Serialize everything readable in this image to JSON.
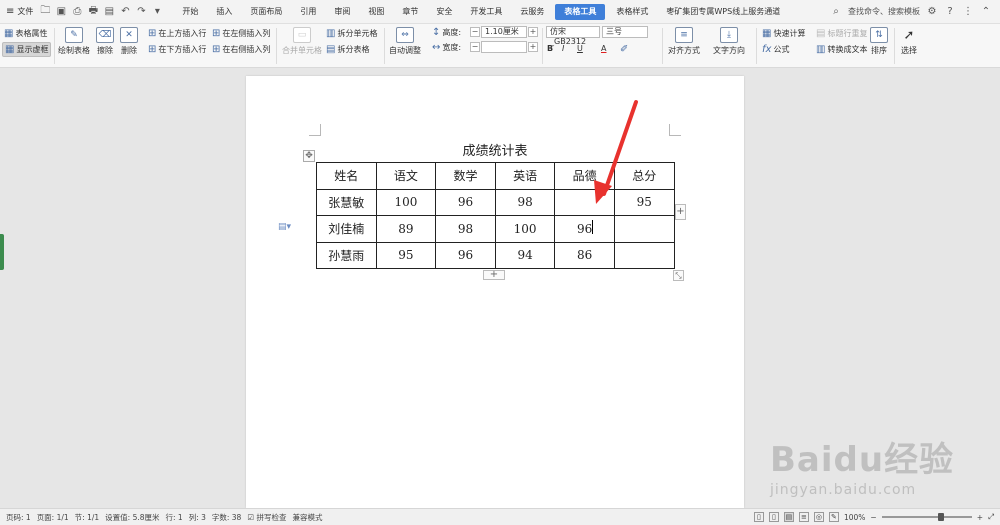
{
  "menu": {
    "file": "文件",
    "tabs": [
      "开始",
      "插入",
      "页面布局",
      "引用",
      "审阅",
      "视图",
      "章节",
      "安全",
      "开发工具",
      "云服务",
      "表格工具",
      "表格样式",
      "枣矿集团专属WPS线上服务通道"
    ],
    "active_tab": "表格工具",
    "search": "查找命令、搜索模板"
  },
  "ribbon": {
    "table_props": "表格属性",
    "show_gridlines": "显示虚框",
    "draw_table": "绘制表格",
    "erase": "擦除",
    "delete": "删除",
    "insert_above": "在上方插入行",
    "insert_below": "在下方插入行",
    "insert_left": "在左侧插入列",
    "insert_right": "在右侧插入列",
    "merge_cells": "合并单元格",
    "split_cells": "拆分单元格",
    "split_table": "拆分表格",
    "auto_fit": "自动调整",
    "height_label": "高度:",
    "height_value": "1.10厘米",
    "width_label": "宽度:",
    "font_name": "仿宋_GB2312",
    "font_size": "三号",
    "bold": "B",
    "italic": "I",
    "underline": "U",
    "font_color": "A",
    "align": "对齐方式",
    "text_direction": "文字方向",
    "quick_calc": "快速计算",
    "repeat_header": "标题行重复",
    "formula": "公式",
    "to_text": "转换成文本",
    "sort": "排序",
    "select": "选择"
  },
  "document": {
    "title": "成绩统计表",
    "header": [
      "姓名",
      "语文",
      "数学",
      "英语",
      "品德",
      "总分"
    ],
    "rows": [
      [
        "张慧敏",
        "100",
        "96",
        "98",
        "",
        "95"
      ],
      [
        "刘佳楠",
        "89",
        "98",
        "100",
        "96",
        ""
      ],
      [
        "孙慧雨",
        "95",
        "96",
        "94",
        "86",
        ""
      ]
    ],
    "arrow_color": "#e8322e"
  },
  "status": {
    "page_num": "页码: 1",
    "pages": "页面: 1/1",
    "section": "节: 1/1",
    "setting": "设置值: 5.8厘米",
    "row": "行: 1",
    "col": "列: 3",
    "chars": "字数: 38",
    "spell": "拼写检查",
    "compat": "兼容模式",
    "zoom": "100%"
  },
  "watermark": {
    "brand": "Bai",
    "brand2": "du",
    "brand3": "经验",
    "url": "jingyan.baidu.com"
  },
  "colors": {
    "accent": "#3f7fd9"
  }
}
